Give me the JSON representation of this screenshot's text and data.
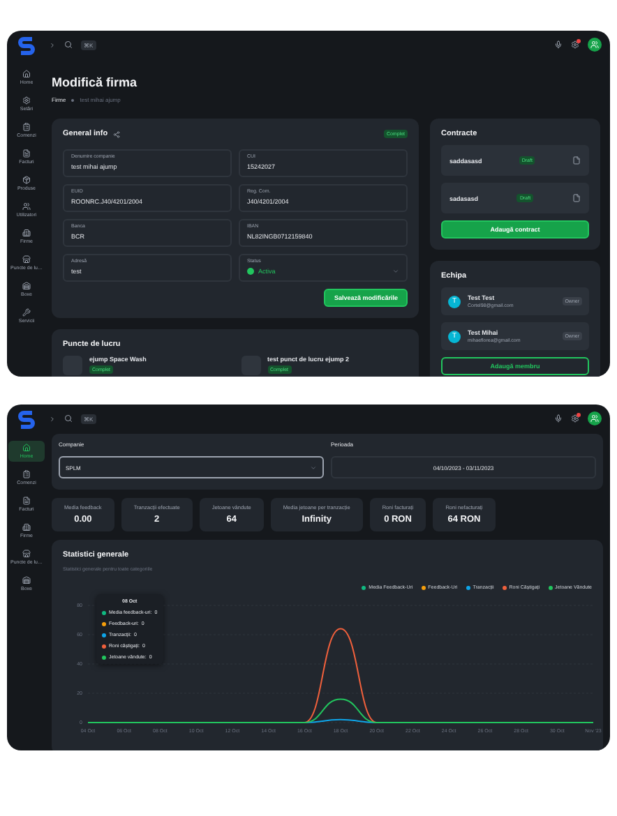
{
  "edit_screen": {
    "sidebar": {
      "items": [
        {
          "label": "Home",
          "selected": false
        },
        {
          "label": "Setări",
          "selected": false
        },
        {
          "label": "Comenzi",
          "selected": false
        },
        {
          "label": "Facturi",
          "selected": false
        },
        {
          "label": "Produse",
          "selected": false
        },
        {
          "label": "Utilizatori",
          "selected": false
        },
        {
          "label": "Firme",
          "selected": false
        },
        {
          "label": "Puncte de lu…",
          "selected": false
        },
        {
          "label": "Boxe",
          "selected": false
        },
        {
          "label": "Servicii",
          "selected": false
        }
      ]
    },
    "topbar": {
      "shortcut": "⌘K"
    },
    "title": "Modifică firma",
    "breadcrumb": [
      "Firme",
      "test mihai ajump"
    ],
    "general_info": {
      "title": "General info",
      "badge": "Complet",
      "fields": [
        {
          "label": "Denumire companie",
          "value": "test mihai ajump"
        },
        {
          "label": "CUI",
          "value": "15242027"
        },
        {
          "label": "EUID",
          "value": "ROONRC.J40/4201/2004"
        },
        {
          "label": "Reg. Com.",
          "value": "J40/4201/2004"
        },
        {
          "label": "Banca",
          "value": "BCR"
        },
        {
          "label": "IBAN",
          "value": "NL82INGB0712159840"
        },
        {
          "label": "Adresă",
          "value": "test"
        },
        {
          "label": "Status",
          "value": "Activa",
          "kind": "select"
        }
      ],
      "save_button": "Salvează modificările"
    },
    "work_points": {
      "title": "Puncte de lucru",
      "items": [
        {
          "name": "ejump Space Wash",
          "badge": "Complet"
        },
        {
          "name": "test punct de lucru ejump 2",
          "badge": "Complet"
        }
      ]
    },
    "contracts": {
      "title": "Contracte",
      "items": [
        {
          "name": "saddasasd",
          "badge": "Draft"
        },
        {
          "name": "sadasasd",
          "badge": "Draft"
        }
      ],
      "add_button": "Adaugă contract"
    },
    "team": {
      "title": "Echipa",
      "members": [
        {
          "avatar": "T",
          "name": "Test Test",
          "email": "Cortel98@gmail.com",
          "role": "Owner"
        },
        {
          "avatar": "T",
          "name": "Test Mihai",
          "email": "mihaeflorea@gmail.com",
          "role": "Owner"
        }
      ],
      "add_button": "Adaugă membru"
    }
  },
  "dashboard_screen": {
    "sidebar": {
      "items": [
        {
          "label": "Home",
          "selected": true
        },
        {
          "label": "Comenzi",
          "selected": false
        },
        {
          "label": "Facturi",
          "selected": false
        },
        {
          "label": "Firme",
          "selected": false
        },
        {
          "label": "Puncte de lu…",
          "selected": false
        },
        {
          "label": "Boxe",
          "selected": false
        }
      ]
    },
    "topbar": {
      "shortcut": "⌘K"
    },
    "filters": {
      "company_label": "Companie",
      "company_value": "SPLM",
      "period_label": "Perioada",
      "period_value": "04/10/2023 - 03/11/2023"
    },
    "stats": [
      {
        "label": "Media feedback",
        "value": "0.00"
      },
      {
        "label": "Tranzacții efectuate",
        "value": "2"
      },
      {
        "label": "Jetoane vândute",
        "value": "64"
      },
      {
        "label": "Media jetoane per tranzacție",
        "value": "Infinity"
      },
      {
        "label": "Roni facturați",
        "value": "0 RON"
      },
      {
        "label": "Roni nefacturați",
        "value": "64 RON"
      }
    ],
    "general_stats": {
      "title": "Statistici generale",
      "subtitle": "Statistici generale pentru toate categoriile",
      "tooltip": {
        "title": "08 Oct",
        "rows": [
          {
            "label": "Media feedback-uri:",
            "value": "0",
            "color": "#10b981"
          },
          {
            "label": "Feedback-uri:",
            "value": "0",
            "color": "#f59e0b"
          },
          {
            "label": "Tranzacții:",
            "value": "0",
            "color": "#0ea5e9"
          },
          {
            "label": "Roni câștigați:",
            "value": "0",
            "color": "#f0603c"
          },
          {
            "label": "Jetoane vândute:",
            "value": "0",
            "color": "#22c55e"
          }
        ]
      },
      "chart_data": {
        "type": "line",
        "grid": true,
        "categories": [
          "04 Oct",
          "06 Oct",
          "08 Oct",
          "10 Oct",
          "12 Oct",
          "14 Oct",
          "16 Oct",
          "18 Oct",
          "20 Oct",
          "22 Oct",
          "24 Oct",
          "26 Oct",
          "28 Oct",
          "30 Oct",
          "Nov '23"
        ],
        "ylim": [
          0,
          80
        ],
        "yticks": [
          0,
          20,
          40,
          60,
          80
        ],
        "series": [
          {
            "name": "Media Feedback-Uri",
            "color": "#10b981",
            "values": [
              null,
              null,
              null,
              null,
              null,
              null,
              null,
              null,
              null,
              null,
              null,
              null,
              null,
              null,
              null
            ]
          },
          {
            "name": "Feedback-Uri",
            "color": "#f59e0b",
            "values": [
              null,
              null,
              null,
              null,
              null,
              null,
              null,
              null,
              null,
              null,
              null,
              null,
              null,
              null,
              null
            ]
          },
          {
            "name": "Tranzacții",
            "color": "#0ea5e9",
            "values": [
              null,
              null,
              null,
              null,
              null,
              null,
              0,
              2,
              0,
              null,
              null,
              null,
              null,
              null,
              null
            ]
          },
          {
            "name": "Roni Câștigați",
            "color": "#f0603c",
            "values": [
              null,
              null,
              null,
              null,
              null,
              null,
              0,
              64,
              0,
              null,
              null,
              null,
              null,
              null,
              null
            ]
          },
          {
            "name": "Jetoane Vândute",
            "color": "#22c55e",
            "values": [
              0,
              0,
              0,
              0,
              0,
              0,
              0,
              16,
              0,
              0,
              0,
              0,
              0,
              0,
              0
            ]
          }
        ]
      }
    }
  }
}
